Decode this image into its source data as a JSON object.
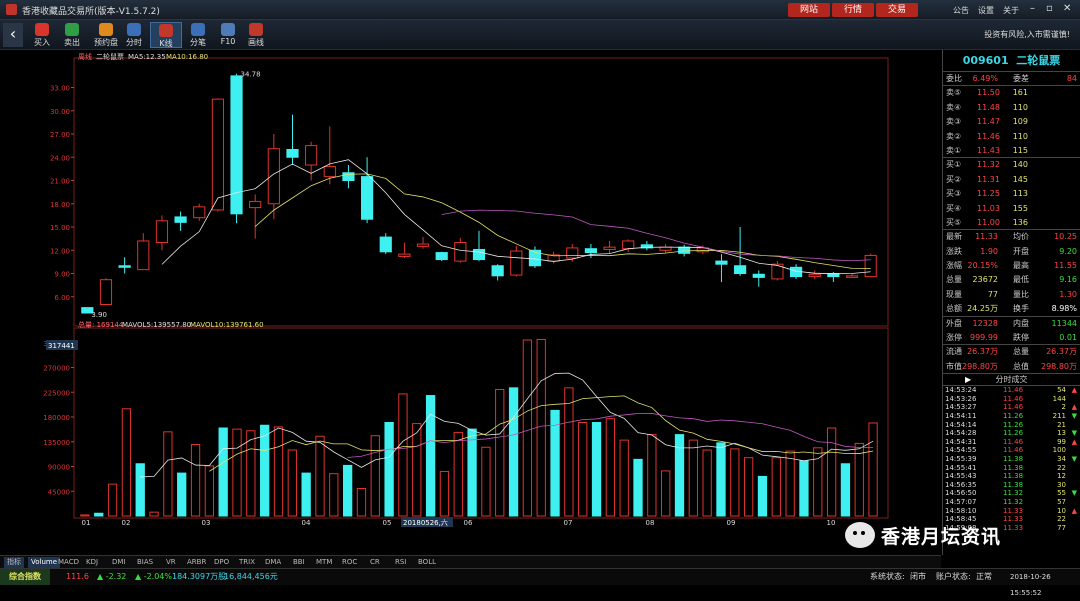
{
  "titlebar": {
    "title": "香港收藏品交易所(版本-V1.5.7.2)",
    "buttons": [
      "网站",
      "行情",
      "交易"
    ],
    "links": [
      "公告",
      "设置",
      "关于"
    ]
  },
  "toolbar": {
    "items": [
      {
        "label": "买入",
        "color": "#d9362b"
      },
      {
        "label": "卖出",
        "color": "#2f9e44"
      },
      {
        "label": "预约盘",
        "color": "#e08a1e"
      },
      {
        "label": "分时",
        "color": "#3b6fb6"
      },
      {
        "label": "K线",
        "color": "#c0392b"
      },
      {
        "label": "分笔",
        "color": "#3b6fb6"
      },
      {
        "label": "F10",
        "color": "#4f7cb9"
      },
      {
        "label": "画线",
        "color": "#c0392b"
      }
    ],
    "warning": "投资有风险,入市需谨慎!"
  },
  "chart": {
    "price_legend": [
      "周线",
      "二轮鼠票",
      "MA5:12.35",
      "MA10:16.80"
    ],
    "vol_legend": [
      "总量: 169144",
      "MAVOL5:139557.80",
      "MAVOL10:139761.60"
    ],
    "high_label": "34.78",
    "low_label": "3.90",
    "vol_cursor": "317441",
    "date_cursor": "20180526,六",
    "price_ticks": [
      "33.00",
      "30.00",
      "27.00",
      "24.00",
      "21.00",
      "18.00",
      "15.00",
      "12.00",
      "9.00",
      "6.00"
    ],
    "vol_ticks": [
      "315000",
      "270000",
      "225000",
      "180000",
      "135000",
      "90000",
      "45000"
    ],
    "month_ticks": [
      "01",
      "02",
      "03",
      "04",
      "05",
      "06",
      "07",
      "08",
      "09",
      "10"
    ]
  },
  "chart_data": {
    "type": "candlestick",
    "candles": [
      {
        "o": 4.6,
        "c": 3.9,
        "h": 4.6,
        "l": 3.9
      },
      {
        "o": 5.0,
        "c": 8.2,
        "h": 8.4,
        "l": 4.9
      },
      {
        "o": 10.0,
        "c": 9.8,
        "h": 11.1,
        "l": 9.0
      },
      {
        "o": 9.5,
        "c": 13.2,
        "h": 14.2,
        "l": 9.5
      },
      {
        "o": 13.0,
        "c": 15.8,
        "h": 16.5,
        "l": 12.0
      },
      {
        "o": 16.3,
        "c": 15.6,
        "h": 17.0,
        "l": 14.5
      },
      {
        "o": 16.2,
        "c": 17.6,
        "h": 18.0,
        "l": 15.8
      },
      {
        "o": 17.2,
        "c": 31.5,
        "h": 31.6,
        "l": 17.0
      },
      {
        "o": 34.5,
        "c": 16.7,
        "h": 34.78,
        "l": 15.5
      },
      {
        "o": 17.5,
        "c": 18.3,
        "h": 19.2,
        "l": 13.5
      },
      {
        "o": 18.0,
        "c": 25.1,
        "h": 27.0,
        "l": 16.0
      },
      {
        "o": 25.0,
        "c": 24.0,
        "h": 29.5,
        "l": 23.0
      },
      {
        "o": 23.0,
        "c": 25.5,
        "h": 26.0,
        "l": 21.0
      },
      {
        "o": 21.5,
        "c": 22.8,
        "h": 28.0,
        "l": 20.5
      },
      {
        "o": 22.0,
        "c": 21.0,
        "h": 23.0,
        "l": 20.0
      },
      {
        "o": 21.5,
        "c": 16.0,
        "h": 24.0,
        "l": 15.5
      },
      {
        "o": 13.7,
        "c": 11.8,
        "h": 14.2,
        "l": 11.5
      },
      {
        "o": 11.2,
        "c": 11.5,
        "h": 13.0,
        "l": 11.0
      },
      {
        "o": 12.5,
        "c": 12.8,
        "h": 13.7,
        "l": 12.2
      },
      {
        "o": 11.7,
        "c": 10.8,
        "h": 11.8,
        "l": 10.6
      },
      {
        "o": 10.6,
        "c": 13.0,
        "h": 13.6,
        "l": 10.4
      },
      {
        "o": 12.1,
        "c": 10.8,
        "h": 14.5,
        "l": 10.6
      },
      {
        "o": 10.0,
        "c": 8.7,
        "h": 10.2,
        "l": 8.1
      },
      {
        "o": 8.8,
        "c": 11.9,
        "h": 12.6,
        "l": 8.6
      },
      {
        "o": 12.0,
        "c": 10.0,
        "h": 12.5,
        "l": 9.7
      },
      {
        "o": 10.6,
        "c": 11.4,
        "h": 11.8,
        "l": 10.3
      },
      {
        "o": 11.0,
        "c": 12.3,
        "h": 12.8,
        "l": 10.5
      },
      {
        "o": 12.2,
        "c": 11.7,
        "h": 12.8,
        "l": 11.0
      },
      {
        "o": 12.1,
        "c": 12.4,
        "h": 13.2,
        "l": 11.6
      },
      {
        "o": 12.2,
        "c": 13.2,
        "h": 13.4,
        "l": 11.8
      },
      {
        "o": 12.7,
        "c": 12.3,
        "h": 13.2,
        "l": 12.0
      },
      {
        "o": 12.0,
        "c": 12.4,
        "h": 12.8,
        "l": 11.7
      },
      {
        "o": 12.4,
        "c": 11.6,
        "h": 12.7,
        "l": 11.2
      },
      {
        "o": 11.8,
        "c": 12.3,
        "h": 12.6,
        "l": 11.5
      },
      {
        "o": 10.6,
        "c": 10.2,
        "h": 11.5,
        "l": 7.9
      },
      {
        "o": 10.0,
        "c": 9.0,
        "h": 15.0,
        "l": 8.7
      },
      {
        "o": 8.9,
        "c": 8.5,
        "h": 9.4,
        "l": 7.3
      },
      {
        "o": 8.3,
        "c": 10.2,
        "h": 10.6,
        "l": 8.1
      },
      {
        "o": 9.8,
        "c": 8.6,
        "h": 10.2,
        "l": 8.3
      },
      {
        "o": 8.6,
        "c": 8.9,
        "h": 9.4,
        "l": 8.3
      },
      {
        "o": 9.0,
        "c": 8.6,
        "h": 9.2,
        "l": 7.9
      },
      {
        "o": 8.5,
        "c": 8.7,
        "h": 9.0,
        "l": 8.4
      },
      {
        "o": 8.6,
        "c": 11.33,
        "h": 11.55,
        "l": 8.5
      }
    ],
    "volume": [
      2000,
      5000,
      58000,
      195000,
      95000,
      7000,
      153000,
      78000,
      130000,
      91000,
      160000,
      158000,
      155000,
      165000,
      162000,
      120000,
      78000,
      145000,
      77000,
      92000,
      50000,
      146000,
      170000,
      222000,
      168000,
      219000,
      81000,
      152000,
      158000,
      125000,
      230000,
      233000,
      320000,
      321000,
      192000,
      233000,
      170000,
      170000,
      177000,
      138000,
      103000,
      148000,
      82000,
      148000,
      138000,
      120000,
      133000,
      122000,
      106000,
      72000,
      106000,
      118000,
      100000,
      124000,
      160000,
      95000,
      132000,
      169144
    ],
    "ma_price": [
      {
        "name": "MA5",
        "color": "#e8e8e8",
        "last": 12.35
      },
      {
        "name": "MA10",
        "color": "#e3e36a",
        "last": 16.8
      }
    ],
    "ma_vol": [
      {
        "name": "MAVOL5",
        "last": 139557.8
      },
      {
        "name": "MAVOL10",
        "last": 139761.6
      }
    ],
    "ylim": [
      3,
      35
    ],
    "vol_ylim": [
      0,
      320000
    ]
  },
  "stock": {
    "code": "009601",
    "name": "二轮鼠票",
    "weibi": {
      "l": "委比",
      "v": "6.49%",
      "l2": "委差",
      "v2": "84"
    },
    "asks": [
      {
        "l": "卖⑤",
        "p": "11.50",
        "q": "161"
      },
      {
        "l": "卖④",
        "p": "11.48",
        "q": "110"
      },
      {
        "l": "卖③",
        "p": "11.47",
        "q": "109"
      },
      {
        "l": "卖②",
        "p": "11.46",
        "q": "110"
      },
      {
        "l": "卖①",
        "p": "11.43",
        "q": "115"
      }
    ],
    "bids": [
      {
        "l": "买①",
        "p": "11.32",
        "q": "140"
      },
      {
        "l": "买②",
        "p": "11.31",
        "q": "145"
      },
      {
        "l": "买③",
        "p": "11.25",
        "q": "113"
      },
      {
        "l": "买④",
        "p": "11.03",
        "q": "155"
      },
      {
        "l": "买⑤",
        "p": "11.00",
        "q": "136"
      }
    ],
    "stats": [
      {
        "l": "最新",
        "v": "11.33",
        "c": "#ff4444",
        "l2": "均价",
        "v2": "10.25",
        "c2": "#ff4444"
      },
      {
        "l": "涨跌",
        "v": "1.90",
        "c": "#ff4444",
        "l2": "开盘",
        "v2": "9.20",
        "c2": "#3adf3a"
      },
      {
        "l": "涨幅",
        "v": "20.15%",
        "c": "#ff4444",
        "l2": "最高",
        "v2": "11.55",
        "c2": "#ff4444"
      },
      {
        "l": "总量",
        "v": "23672",
        "c": "#e3e36a",
        "l2": "最低",
        "v2": "9.16",
        "c2": "#3adf3a"
      },
      {
        "l": "现量",
        "v": "77",
        "c": "#e3e36a",
        "l2": "量比",
        "v2": "1.30",
        "c2": "#ff4444"
      },
      {
        "l": "总额",
        "v": "24.25万",
        "c": "#e3e36a",
        "l2": "换手",
        "v2": "8.98%",
        "c2": "#ffffff"
      }
    ],
    "stats2": [
      {
        "l": "外盘",
        "v": "12328",
        "c": "#ff4444",
        "l2": "内盘",
        "v2": "11344",
        "c2": "#3adf3a"
      },
      {
        "l": "涨停",
        "v": "999.99",
        "c": "#ff4444",
        "l2": "跌停",
        "v2": "0.01",
        "c2": "#3adf3a"
      }
    ],
    "stats3": [
      {
        "l": "流通",
        "v": "26.37万",
        "c": "#ff4444",
        "l2": "总量",
        "v2": "26.37万",
        "c2": "#ff4444"
      },
      {
        "l": "市值",
        "v": "298.80万",
        "c": "#ff4444",
        "l2": "总值",
        "v2": "298.80万",
        "c2": "#ff4444"
      }
    ],
    "ticks_title": "分时成交",
    "ticks": [
      {
        "t": "14:53:24",
        "p": "11.46",
        "v": "54",
        "a": "▲",
        "c": "#ff4444"
      },
      {
        "t": "14:53:26",
        "p": "11.46",
        "v": "144",
        "a": "",
        "c": "#ff4444"
      },
      {
        "t": "14:53:27",
        "p": "11.46",
        "v": "2",
        "a": "▲",
        "c": "#ff4444"
      },
      {
        "t": "14:54:11",
        "p": "11.26",
        "v": "211",
        "a": "▼",
        "c": "#3adf3a"
      },
      {
        "t": "14:54:14",
        "p": "11.26",
        "v": "21",
        "a": "",
        "c": "#3adf3a"
      },
      {
        "t": "14:54:28",
        "p": "11.26",
        "v": "13",
        "a": "▼",
        "c": "#3adf3a"
      },
      {
        "t": "14:54:31",
        "p": "11.46",
        "v": "99",
        "a": "▲",
        "c": "#ff4444"
      },
      {
        "t": "14:54:55",
        "p": "11.46",
        "v": "100",
        "a": "",
        "c": "#ff4444"
      },
      {
        "t": "14:55:39",
        "p": "11.38",
        "v": "34",
        "a": "▼",
        "c": "#3adf3a"
      },
      {
        "t": "14:55:41",
        "p": "11.38",
        "v": "22",
        "a": "",
        "c": "#3adf3a"
      },
      {
        "t": "14:55:43",
        "p": "11.38",
        "v": "12",
        "a": "",
        "c": "#3adf3a"
      },
      {
        "t": "14:56:35",
        "p": "11.38",
        "v": "30",
        "a": "",
        "c": "#3adf3a"
      },
      {
        "t": "14:56:50",
        "p": "11.32",
        "v": "55",
        "a": "▼",
        "c": "#3adf3a"
      },
      {
        "t": "14:57:07",
        "p": "11.32",
        "v": "57",
        "a": "",
        "c": "#3adf3a"
      },
      {
        "t": "14:58:10",
        "p": "11.33",
        "v": "10",
        "a": "▲",
        "c": "#ff4444"
      },
      {
        "t": "14:58:45",
        "p": "11.33",
        "v": "22",
        "a": "",
        "c": "#ff4444"
      },
      {
        "t": "14:59:08",
        "p": "11.33",
        "v": "77",
        "a": "",
        "c": "#ff4444"
      }
    ]
  },
  "tabs": [
    "指标",
    "Volume",
    "MACD",
    "KDJ",
    "DMI",
    "BIAS",
    "VR",
    "ARBR",
    "DPO",
    "TRIX",
    "DMA",
    "BBI",
    "MTM",
    "ROC",
    "CR",
    "RSI",
    "BOLL"
  ],
  "status": {
    "index_label": "综合指数",
    "index_val": "111.6",
    "change": "▲ -2.32",
    "pct": "▲ -2.04%",
    "vol": "184.3097万股",
    "amount": "16,844,456元",
    "sys_label": "系统状态:",
    "sys_val": "闭市",
    "acct_label": "账户状态:",
    "acct_val": "正常",
    "datetime": "2018-10-26 15:55:52"
  },
  "watermark": "香港月坛资讯"
}
